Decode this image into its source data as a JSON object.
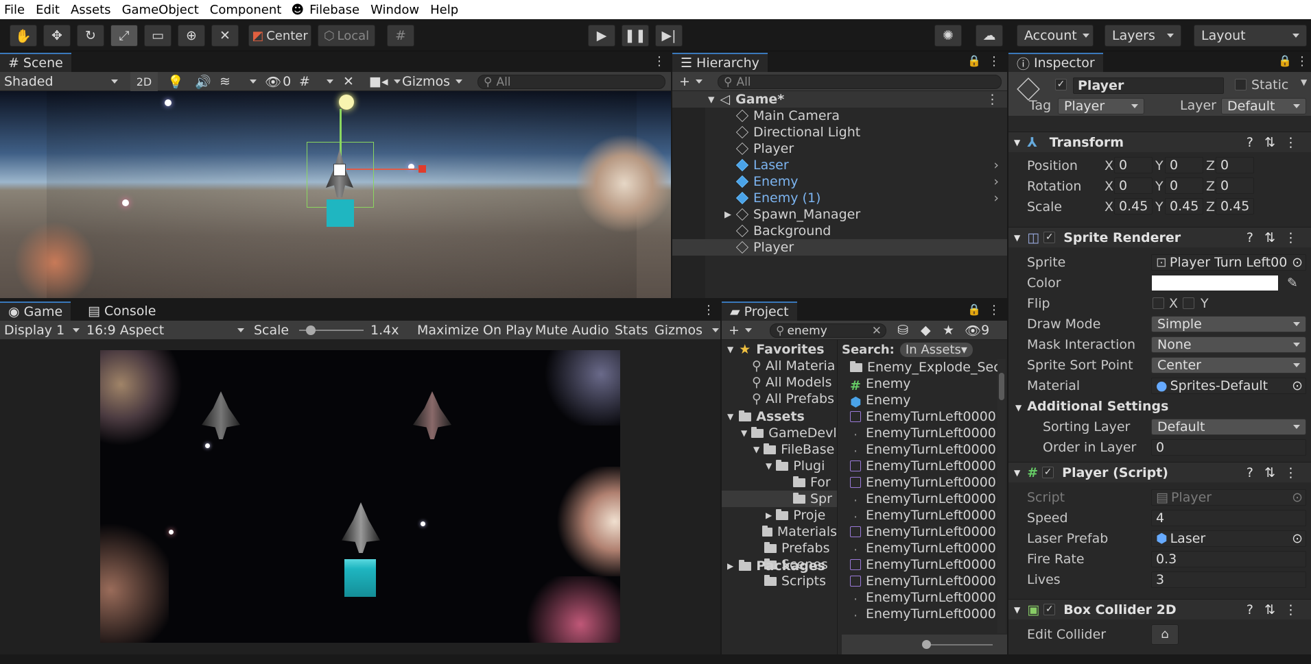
{
  "menubar": [
    "File",
    "Edit",
    "Assets",
    "GameObject",
    "Component",
    "Filebase",
    "Window",
    "Help"
  ],
  "toolbar": {
    "center": "Center",
    "local": "Local",
    "account": "Account",
    "layers": "Layers",
    "layout": "Layout"
  },
  "scene": {
    "tab": "Scene",
    "shading": "Shaded",
    "mode2d": "2D",
    "hidden_count": "0",
    "gizmos": "Gizmos",
    "search_placeholder": "All"
  },
  "hierarchy": {
    "tab": "Hierarchy",
    "search_placeholder": "All",
    "root": "Game*",
    "items": [
      {
        "label": "Main Camera",
        "prefab": false
      },
      {
        "label": "Directional Light",
        "prefab": false
      },
      {
        "label": "Player",
        "prefab": false
      },
      {
        "label": "Laser",
        "prefab": true
      },
      {
        "label": "Enemy",
        "prefab": true
      },
      {
        "label": "Enemy (1)",
        "prefab": true
      },
      {
        "label": "Spawn_Manager",
        "prefab": false
      },
      {
        "label": "Background",
        "prefab": false
      },
      {
        "label": "Player",
        "prefab": false
      }
    ]
  },
  "game": {
    "tab": "Game",
    "console_tab": "Console",
    "display": "Display 1",
    "aspect": "16:9 Aspect",
    "scale_label": "Scale",
    "scale_value": "1.4x",
    "maximize": "Maximize On Play",
    "mute": "Mute Audio",
    "stats": "Stats",
    "gizmos": "Gizmos"
  },
  "project": {
    "tab": "Project",
    "search_value": "enemy",
    "hidden_count": "9",
    "search_label": "Search:",
    "search_scope": "In Assets",
    "favorites": {
      "title": "Favorites",
      "items": [
        "All Materia",
        "All Models",
        "All Prefabs"
      ]
    },
    "assets": {
      "title": "Assets",
      "items": [
        "GameDevl",
        "FileBase",
        "Plugi",
        "For",
        "Spr",
        "Proje",
        "Materials",
        "Prefabs",
        "Scenes",
        "Scripts"
      ]
    },
    "packages": "Packages",
    "results": [
      "Enemy_Explode_Sec",
      "Enemy",
      "Enemy",
      "EnemyTurnLeft0000",
      "EnemyTurnLeft0000",
      "EnemyTurnLeft0000",
      "EnemyTurnLeft0000",
      "EnemyTurnLeft0000",
      "EnemyTurnLeft0000",
      "EnemyTurnLeft0000",
      "EnemyTurnLeft0000",
      "EnemyTurnLeft0000",
      "EnemyTurnLeft0000",
      "EnemyTurnLeft0000",
      "EnemyTurnLeft0000",
      "EnemyTurnLeft0000"
    ]
  },
  "inspector": {
    "tab": "Inspector",
    "object_name": "Player",
    "static": "Static",
    "tag_label": "Tag",
    "tag_value": "Player",
    "layer_label": "Layer",
    "layer_value": "Default",
    "transform": {
      "title": "Transform",
      "position_label": "Position",
      "rotation_label": "Rotation",
      "scale_label": "Scale",
      "position": [
        "0",
        "0",
        "0"
      ],
      "rotation": [
        "0",
        "0",
        "0"
      ],
      "scale": [
        "0.45",
        "0.45",
        "0.45"
      ]
    },
    "sprite_renderer": {
      "title": "Sprite Renderer",
      "sprite_label": "Sprite",
      "sprite_value": "Player Turn Left00",
      "color_label": "Color",
      "flip_label": "Flip",
      "flip_x": "X",
      "flip_y": "Y",
      "draw_mode_label": "Draw Mode",
      "draw_mode": "Simple",
      "mask_label": "Mask Interaction",
      "mask": "None",
      "sort_point_label": "Sprite Sort Point",
      "sort_point": "Center",
      "material_label": "Material",
      "material": "Sprites-Default",
      "additional": "Additional Settings",
      "sorting_layer_label": "Sorting Layer",
      "sorting_layer": "Default",
      "order_label": "Order in Layer",
      "order": "0"
    },
    "player_script": {
      "title": "Player (Script)",
      "script_label": "Script",
      "script_value": "Player",
      "speed_label": "Speed",
      "speed": "4",
      "laser_label": "Laser Prefab",
      "laser": "Laser",
      "fire_rate_label": "Fire Rate",
      "fire_rate": "0.3",
      "lives_label": "Lives",
      "lives": "3"
    },
    "box_collider": {
      "title": "Box Collider 2D",
      "edit_label": "Edit Collider"
    }
  },
  "colors": {
    "accent": "#3a79bb",
    "prefab_blue": "#7cb4f0",
    "cyan_cube": "#1fb6c1"
  }
}
